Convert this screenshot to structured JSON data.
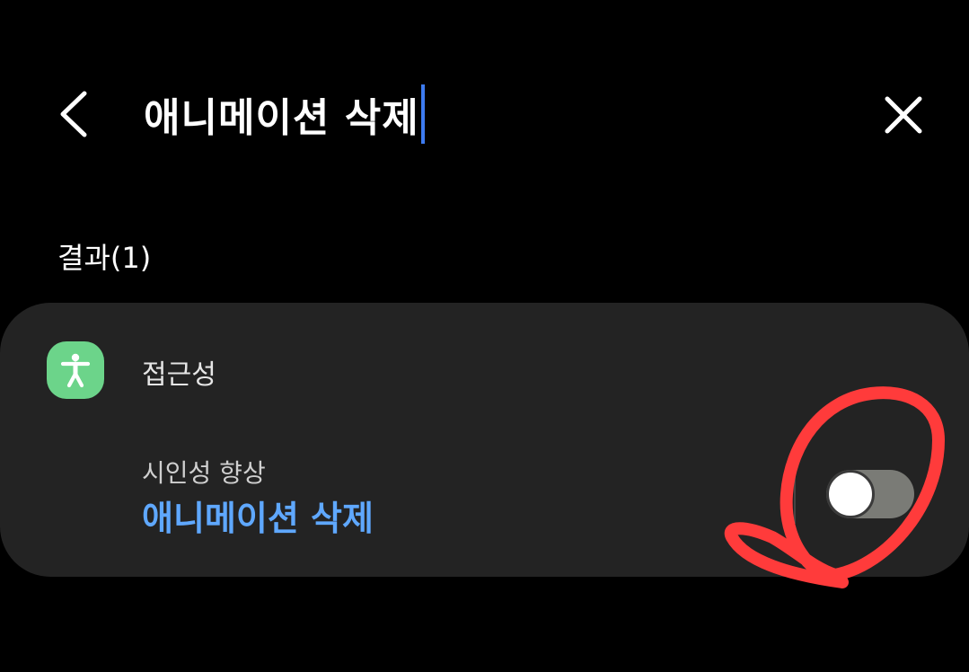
{
  "header": {
    "back_icon": "chevron-left-icon",
    "search_value": "애니메이션 삭제",
    "caret_color": "#3d7bf0",
    "close_icon": "close-icon"
  },
  "results": {
    "label": "결과(1)"
  },
  "result_card": {
    "category": {
      "label": "접근성",
      "icon": "accessibility-icon",
      "icon_color": "#6cd48a"
    },
    "item": {
      "breadcrumb": "시인성 향상",
      "title": "애니메이션 삭제",
      "title_color": "#5fa8ff",
      "toggle_on": false
    }
  },
  "annotation": {
    "type": "hand-drawn-circle",
    "color": "#ff3b3b"
  }
}
